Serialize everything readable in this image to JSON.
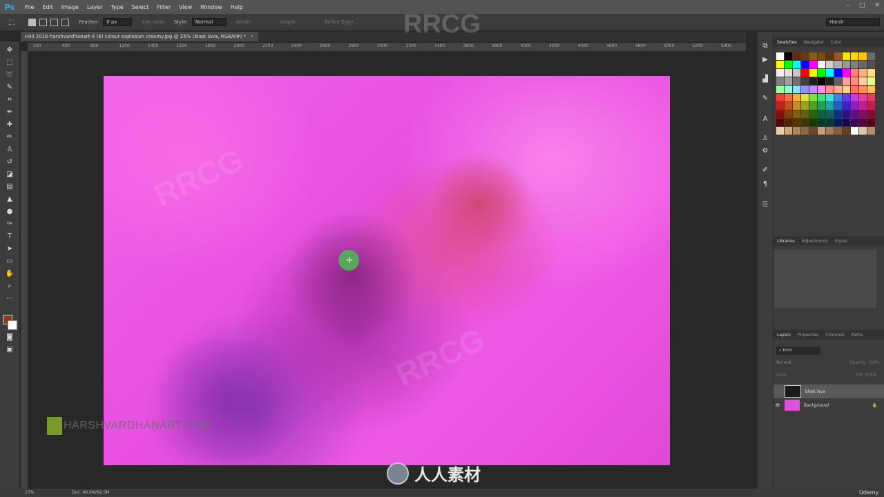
{
  "app": {
    "logo": "Ps"
  },
  "menu": [
    "File",
    "Edit",
    "Image",
    "Layer",
    "Type",
    "Select",
    "Filter",
    "View",
    "Window",
    "Help"
  ],
  "window_controls": [
    "–",
    "□",
    "✕"
  ],
  "options": {
    "feather_label": "Feather:",
    "feather_value": "0 px",
    "antialias_label": "Anti-alias",
    "style_label": "Style:",
    "style_value": "Normal",
    "width_label": "Width:",
    "height_label": "Height:",
    "refine_edge": "Refine Edge...",
    "workspace": "Harsh"
  },
  "document": {
    "tab_title": "Holi 2016-harshvardhanart-4 (6) colour explosion creamy.jpg @ 25% (blast lava, RGB/8#) *",
    "ruler_labels": [
      "100",
      "400",
      "800",
      "1200",
      "1400",
      "1600",
      "1800",
      "2000",
      "2200",
      "2400",
      "2600",
      "2800",
      "3000",
      "3200",
      "3400",
      "3600",
      "3800",
      "4000",
      "4200",
      "4400",
      "4600",
      "4800",
      "5000",
      "5200",
      "5400"
    ],
    "brand_text": "HARSHVARDHANART.COM"
  },
  "watermarks": {
    "top": "RRCG",
    "bottom": "人人素材"
  },
  "panels": {
    "top_tabs": [
      "Swatches",
      "Navigator",
      "Color"
    ],
    "mid_tabs": [
      "Libraries",
      "Adjustments",
      "Styles"
    ],
    "layer_tabs": [
      "Layers",
      "Properties",
      "Channels",
      "Paths"
    ],
    "layers_kind": "Kind",
    "blend_mode": "Normal",
    "opacity_label": "Opacity: 100%",
    "lock_label": "Lock:",
    "fill_label": "Fill: 100%",
    "layers": [
      {
        "name": "blast lava"
      },
      {
        "name": "Background"
      }
    ],
    "swatch_colors": [
      "#ffffff",
      "#000000",
      "#5a2d0c",
      "#6b3a12",
      "#8a5a1a",
      "#7a4a10",
      "#5b3410",
      "#a0522d",
      "#f2e600",
      "#ffd400",
      "#ffc800",
      "#6b6b6b",
      "#ffff00",
      "#00ff00",
      "#00ffff",
      "#0000ff",
      "#ff00ff",
      "#ffffff",
      "#d0d0d0",
      "#b0b0b0",
      "#989898",
      "#808080",
      "#686868",
      "#505050",
      "#f0f0f0",
      "#e0e0e0",
      "#c8c8c8",
      "#ff0000",
      "#ffff00",
      "#00ff00",
      "#00ffff",
      "#0000ff",
      "#ff00ff",
      "#ff8080",
      "#ffb080",
      "#ffe080",
      "#808080",
      "#a0a0a0",
      "#707070",
      "#404040",
      "#202020",
      "#000000",
      "#202020",
      "#606060",
      "#ffa0a0",
      "#ff9080",
      "#ffd0a0",
      "#e0ff90",
      "#a0ffa0",
      "#90ffd0",
      "#90e0ff",
      "#9090ff",
      "#c090ff",
      "#ff90e0",
      "#ff9090",
      "#ffb090",
      "#ffd090",
      "#ff7070",
      "#ff9060",
      "#ffc060",
      "#f04040",
      "#f07040",
      "#f0b040",
      "#e0e040",
      "#80e040",
      "#40e080",
      "#40e0e0",
      "#4080e0",
      "#6040e0",
      "#c040e0",
      "#e040a0",
      "#e04060",
      "#c02020",
      "#c05020",
      "#c09020",
      "#a0a020",
      "#50a020",
      "#20a060",
      "#20a0a0",
      "#2060c0",
      "#4020c0",
      "#9020c0",
      "#c02090",
      "#c02050",
      "#801010",
      "#804010",
      "#806010",
      "#606010",
      "#306010",
      "#106040",
      "#106060",
      "#103080",
      "#301080",
      "#601080",
      "#801060",
      "#801030",
      "#500808",
      "#502008",
      "#503808",
      "#383808",
      "#183808",
      "#083828",
      "#083838",
      "#081850",
      "#180850",
      "#380850",
      "#500838",
      "#500818",
      "#e8d0b0",
      "#c8a880",
      "#a88860",
      "#886848",
      "#684830",
      "#c0a080",
      "#a08060",
      "#806040",
      "#604020",
      "#ffffff",
      "#d8c8b0",
      "#b09070"
    ]
  },
  "status": {
    "zoom": "25%",
    "doc": "Doc: 46.0M/92.0M"
  },
  "overlays": {
    "udemy": "Udemy"
  }
}
